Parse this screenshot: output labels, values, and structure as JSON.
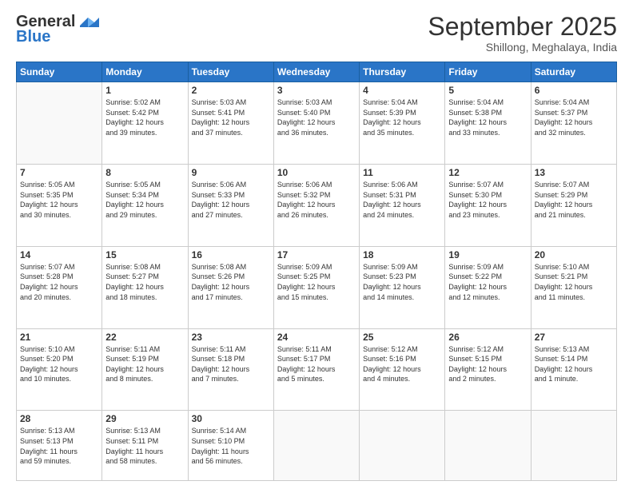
{
  "header": {
    "logo_general": "General",
    "logo_blue": "Blue",
    "month_title": "September 2025",
    "subtitle": "Shillong, Meghalaya, India"
  },
  "days_of_week": [
    "Sunday",
    "Monday",
    "Tuesday",
    "Wednesday",
    "Thursday",
    "Friday",
    "Saturday"
  ],
  "weeks": [
    [
      {
        "day": "",
        "info": ""
      },
      {
        "day": "1",
        "info": "Sunrise: 5:02 AM\nSunset: 5:42 PM\nDaylight: 12 hours\nand 39 minutes."
      },
      {
        "day": "2",
        "info": "Sunrise: 5:03 AM\nSunset: 5:41 PM\nDaylight: 12 hours\nand 37 minutes."
      },
      {
        "day": "3",
        "info": "Sunrise: 5:03 AM\nSunset: 5:40 PM\nDaylight: 12 hours\nand 36 minutes."
      },
      {
        "day": "4",
        "info": "Sunrise: 5:04 AM\nSunset: 5:39 PM\nDaylight: 12 hours\nand 35 minutes."
      },
      {
        "day": "5",
        "info": "Sunrise: 5:04 AM\nSunset: 5:38 PM\nDaylight: 12 hours\nand 33 minutes."
      },
      {
        "day": "6",
        "info": "Sunrise: 5:04 AM\nSunset: 5:37 PM\nDaylight: 12 hours\nand 32 minutes."
      }
    ],
    [
      {
        "day": "7",
        "info": "Sunrise: 5:05 AM\nSunset: 5:35 PM\nDaylight: 12 hours\nand 30 minutes."
      },
      {
        "day": "8",
        "info": "Sunrise: 5:05 AM\nSunset: 5:34 PM\nDaylight: 12 hours\nand 29 minutes."
      },
      {
        "day": "9",
        "info": "Sunrise: 5:06 AM\nSunset: 5:33 PM\nDaylight: 12 hours\nand 27 minutes."
      },
      {
        "day": "10",
        "info": "Sunrise: 5:06 AM\nSunset: 5:32 PM\nDaylight: 12 hours\nand 26 minutes."
      },
      {
        "day": "11",
        "info": "Sunrise: 5:06 AM\nSunset: 5:31 PM\nDaylight: 12 hours\nand 24 minutes."
      },
      {
        "day": "12",
        "info": "Sunrise: 5:07 AM\nSunset: 5:30 PM\nDaylight: 12 hours\nand 23 minutes."
      },
      {
        "day": "13",
        "info": "Sunrise: 5:07 AM\nSunset: 5:29 PM\nDaylight: 12 hours\nand 21 minutes."
      }
    ],
    [
      {
        "day": "14",
        "info": "Sunrise: 5:07 AM\nSunset: 5:28 PM\nDaylight: 12 hours\nand 20 minutes."
      },
      {
        "day": "15",
        "info": "Sunrise: 5:08 AM\nSunset: 5:27 PM\nDaylight: 12 hours\nand 18 minutes."
      },
      {
        "day": "16",
        "info": "Sunrise: 5:08 AM\nSunset: 5:26 PM\nDaylight: 12 hours\nand 17 minutes."
      },
      {
        "day": "17",
        "info": "Sunrise: 5:09 AM\nSunset: 5:25 PM\nDaylight: 12 hours\nand 15 minutes."
      },
      {
        "day": "18",
        "info": "Sunrise: 5:09 AM\nSunset: 5:23 PM\nDaylight: 12 hours\nand 14 minutes."
      },
      {
        "day": "19",
        "info": "Sunrise: 5:09 AM\nSunset: 5:22 PM\nDaylight: 12 hours\nand 12 minutes."
      },
      {
        "day": "20",
        "info": "Sunrise: 5:10 AM\nSunset: 5:21 PM\nDaylight: 12 hours\nand 11 minutes."
      }
    ],
    [
      {
        "day": "21",
        "info": "Sunrise: 5:10 AM\nSunset: 5:20 PM\nDaylight: 12 hours\nand 10 minutes."
      },
      {
        "day": "22",
        "info": "Sunrise: 5:11 AM\nSunset: 5:19 PM\nDaylight: 12 hours\nand 8 minutes."
      },
      {
        "day": "23",
        "info": "Sunrise: 5:11 AM\nSunset: 5:18 PM\nDaylight: 12 hours\nand 7 minutes."
      },
      {
        "day": "24",
        "info": "Sunrise: 5:11 AM\nSunset: 5:17 PM\nDaylight: 12 hours\nand 5 minutes."
      },
      {
        "day": "25",
        "info": "Sunrise: 5:12 AM\nSunset: 5:16 PM\nDaylight: 12 hours\nand 4 minutes."
      },
      {
        "day": "26",
        "info": "Sunrise: 5:12 AM\nSunset: 5:15 PM\nDaylight: 12 hours\nand 2 minutes."
      },
      {
        "day": "27",
        "info": "Sunrise: 5:13 AM\nSunset: 5:14 PM\nDaylight: 12 hours\nand 1 minute."
      }
    ],
    [
      {
        "day": "28",
        "info": "Sunrise: 5:13 AM\nSunset: 5:13 PM\nDaylight: 11 hours\nand 59 minutes."
      },
      {
        "day": "29",
        "info": "Sunrise: 5:13 AM\nSunset: 5:11 PM\nDaylight: 11 hours\nand 58 minutes."
      },
      {
        "day": "30",
        "info": "Sunrise: 5:14 AM\nSunset: 5:10 PM\nDaylight: 11 hours\nand 56 minutes."
      },
      {
        "day": "",
        "info": ""
      },
      {
        "day": "",
        "info": ""
      },
      {
        "day": "",
        "info": ""
      },
      {
        "day": "",
        "info": ""
      }
    ]
  ]
}
